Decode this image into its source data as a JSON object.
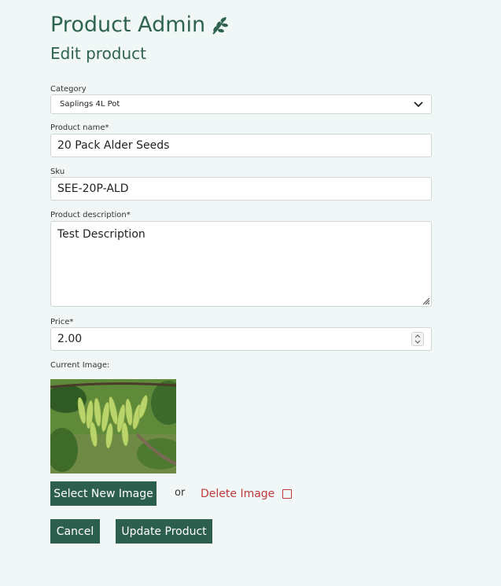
{
  "header": {
    "title": "Product Admin",
    "subtitle": "Edit product",
    "title_icon": "leaf-icon"
  },
  "form": {
    "category": {
      "label": "Category",
      "value": "Saplings 4L Pot"
    },
    "name": {
      "label": "Product name*",
      "value": "20 Pack Alder Seeds"
    },
    "sku": {
      "label": "Sku",
      "value": "SEE-20P-ALD"
    },
    "description": {
      "label": "Product description*",
      "value": "Test Description"
    },
    "price": {
      "label": "Price*",
      "value": "2.00"
    },
    "image": {
      "label": "Current Image:"
    }
  },
  "actions": {
    "select_image": "Select New Image",
    "or": "or",
    "delete_image": "Delete Image",
    "cancel": "Cancel",
    "update": "Update Product"
  },
  "colors": {
    "accent": "#2d5f4e",
    "title": "#2e6352",
    "danger": "#c0393c",
    "background": "#f1f7f6"
  }
}
